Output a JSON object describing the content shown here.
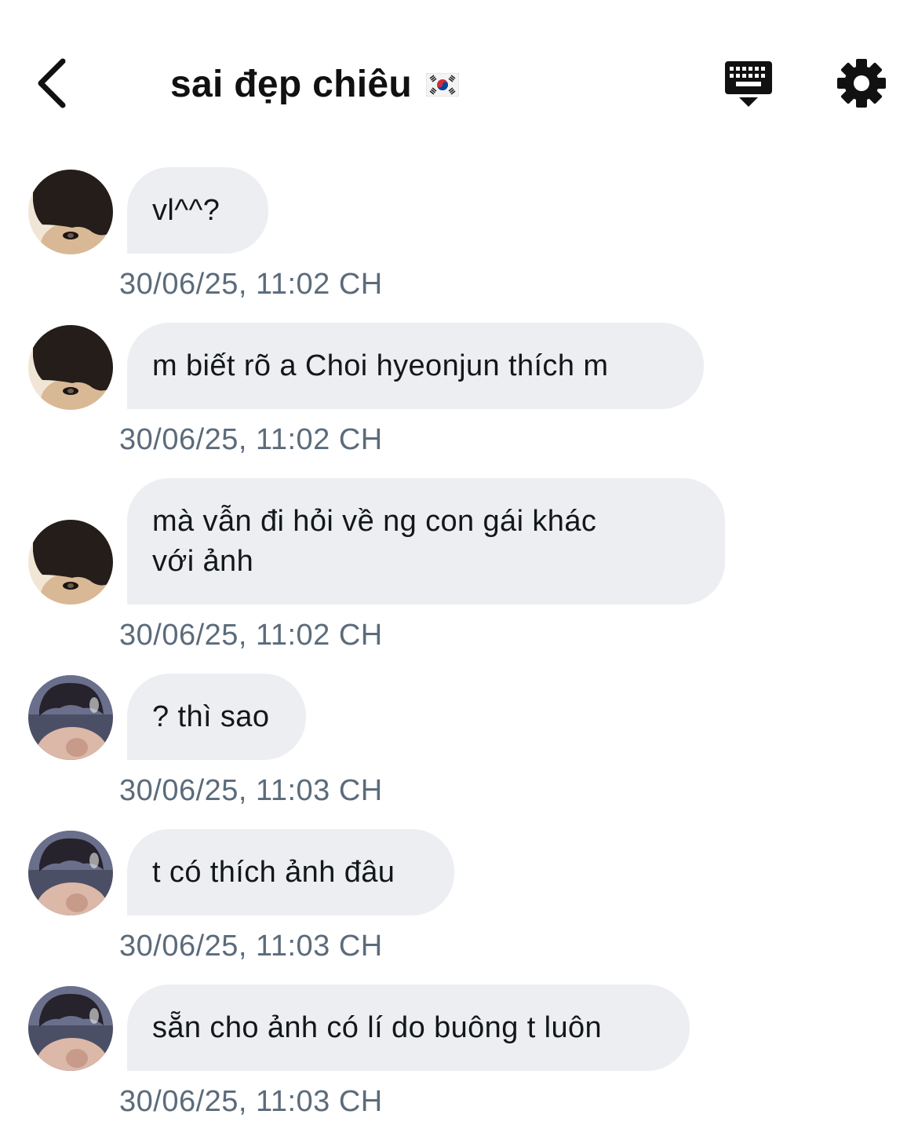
{
  "header": {
    "title": "sai đẹp chiêu",
    "back_icon": "chevron-left-icon",
    "keyboard_icon": "keyboard-icon",
    "settings_icon": "gear-icon",
    "flag_icon": "south-korea-flag-icon"
  },
  "messages": [
    {
      "text": "vl^^?",
      "timestamp": "30/06/25, 11:02 CH",
      "avatar": "avatar-a"
    },
    {
      "text": "m biết rõ a Choi hyeonjun thích m",
      "timestamp": "30/06/25, 11:02 CH",
      "avatar": "avatar-a"
    },
    {
      "text": "mà vẫn đi hỏi về ng con gái khác\nvới ảnh",
      "timestamp": "30/06/25, 11:02 CH",
      "avatar": "avatar-a"
    },
    {
      "text": "? thì sao",
      "timestamp": "30/06/25, 11:03 CH",
      "avatar": "avatar-b"
    },
    {
      "text": "t có thích ảnh đâu",
      "timestamp": "30/06/25, 11:03 CH",
      "avatar": "avatar-b"
    },
    {
      "text": "sẵn cho ảnh có lí do buông t luôn",
      "timestamp": "30/06/25, 11:03 CH",
      "avatar": "avatar-b"
    }
  ],
  "colors": {
    "bubble_bg": "#eceef2",
    "timestamp": "#5b6b7b",
    "text": "#14171a"
  }
}
